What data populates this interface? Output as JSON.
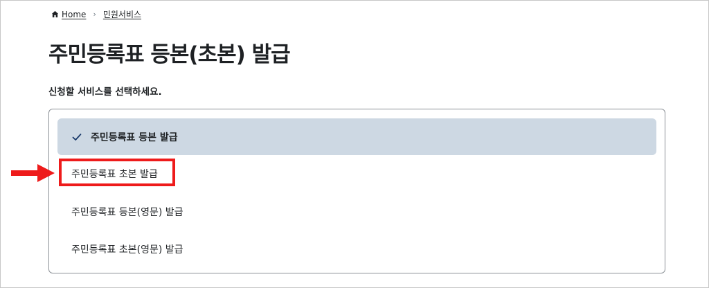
{
  "breadcrumb": {
    "home": "Home",
    "current": "민원서비스"
  },
  "page": {
    "title": "주민등록표 등본(초본) 발급",
    "instruction": "신청할 서비스를 선택하세요."
  },
  "options": [
    {
      "label": "주민등록표 등본 발급",
      "selected": true
    },
    {
      "label": "주민등록표 초본 발급",
      "selected": false,
      "highlighted": true
    },
    {
      "label": "주민등록표 등본(영문) 발급",
      "selected": false
    },
    {
      "label": "주민등록표 초본(영문) 발급",
      "selected": false
    }
  ],
  "icons": {
    "home": "home-icon",
    "separator": "chevron-right-icon",
    "check": "check-icon",
    "annotation": "red-arrow-icon"
  },
  "colors": {
    "selected_background": "#cdd8e3",
    "check": "#1a3a6b",
    "annotation": "#ee1b1b",
    "text": "#1e2124"
  }
}
